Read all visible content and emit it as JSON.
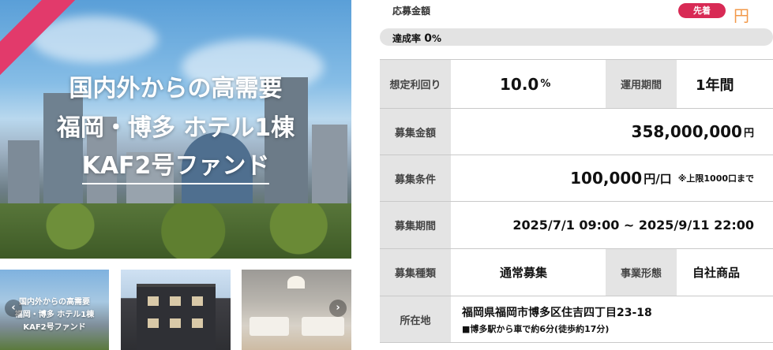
{
  "hero": {
    "title_line1": "国内外からの高需要",
    "title_line2": "福岡・博多 ホテル1棟",
    "title_line3": "KAF2号ファンド"
  },
  "thumbnails": [
    {
      "title_line1": "国内外からの高需要",
      "title_line2": "福岡・博多 ホテル1棟",
      "title_line3": "KAF2号ファンド"
    },
    {
      "caption": ""
    },
    {
      "caption": ""
    }
  ],
  "gallery_nav": {
    "prev": "‹",
    "next": "›"
  },
  "funding": {
    "label": "応募金額",
    "badge": "先着",
    "yen": "円",
    "progress_label": "達成率",
    "progress_value": "0",
    "progress_unit": "%",
    "progress_fraction": 0
  },
  "details": {
    "yield_label": "想定利回り",
    "yield_value": "10.0",
    "yield_unit": "%",
    "period_label": "運用期間",
    "period_value": "1年間",
    "amount_label": "募集金額",
    "amount_value": "358,000,000",
    "amount_unit": "円",
    "terms_label": "募集条件",
    "terms_value": "100,000",
    "terms_unit": "円/口",
    "terms_note": "※上限1000口まで",
    "dates_label": "募集期間",
    "dates_value": "2025/7/1 09:00 ~ 2025/9/11 22:00",
    "type_label": "募集種類",
    "type_value": "通常募集",
    "business_label": "事業形態",
    "business_value": "自社商品",
    "location_label": "所在地",
    "location_value": "福岡県福岡市博多区住吉四丁目23-18",
    "location_access": "■博多駅から車で約6分(徒歩約17分)"
  },
  "colors": {
    "accent_pink": "#d82a55",
    "accent_orange": "#f2994a",
    "label_bg": "#e4e4e4"
  }
}
